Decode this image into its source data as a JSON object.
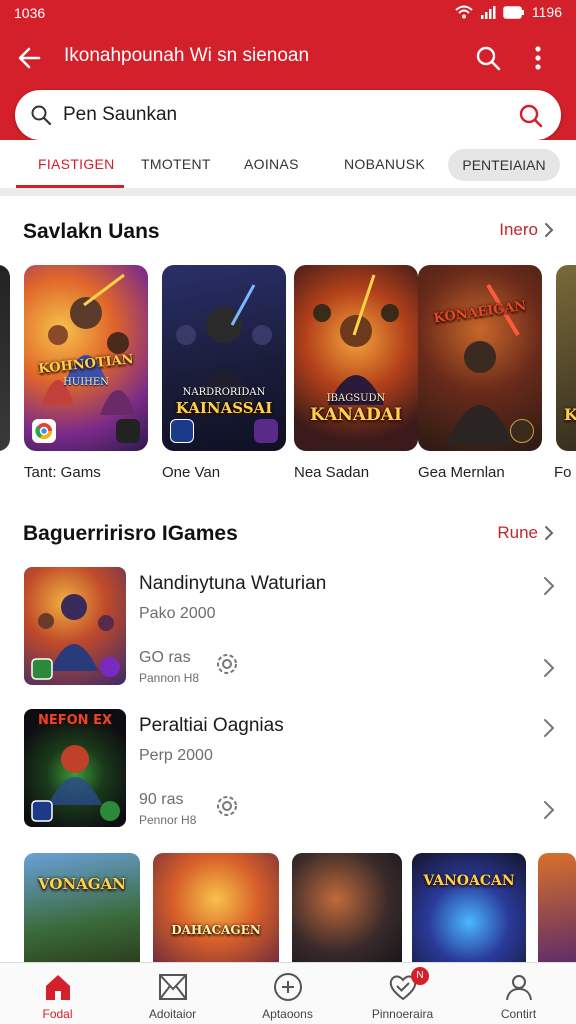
{
  "status_bar": {
    "time": "1036",
    "battery": "1196"
  },
  "app_bar": {
    "title": "Ikonahpounah Wi sn sienoan"
  },
  "search": {
    "value": "Pen Saunkan"
  },
  "tabs": [
    {
      "label": "FIASTIGEN",
      "active": true
    },
    {
      "label": "TMOTENT",
      "active": false
    },
    {
      "label": "AOINAS",
      "active": false
    },
    {
      "label": "NOBANUSK",
      "active": false
    },
    {
      "label": "PENTEIAIAN",
      "active": false
    }
  ],
  "featured": {
    "title": "Savlakn Uans",
    "more_label": "Inero",
    "cards": [
      {
        "label": "Tant: Gams",
        "art_title": "KOHNOTIAN",
        "art_sub": "HUIHEN",
        "icon": "chrome-badge-icon"
      },
      {
        "label": "One Van",
        "art_title": "KAINASSAI",
        "art_sub": "NARDRORIDAN",
        "icon": "game-badge-icon"
      },
      {
        "label": "Nea Sadan",
        "art_title": "KANADAI",
        "art_sub": "IBAGSUDN",
        "icon": "game-badge-icon"
      },
      {
        "label": "Gea Mernlan",
        "art_title": "KONAEIGAN",
        "art_sub": "",
        "icon": "game-badge-icon"
      },
      {
        "label": "Fo",
        "art_title": "K",
        "art_sub": "",
        "icon": "game-badge-icon"
      }
    ]
  },
  "popular": {
    "title": "Baguerririsro IGames",
    "more_label": "Rune",
    "items": [
      {
        "title": "Nandinytuna Waturian",
        "subtitle": "Pako 2000",
        "meta_primary": "GO ras",
        "meta_secondary": "Pannon H8"
      },
      {
        "title": "Peraltiai Oagnias",
        "subtitle": "Perp 2000",
        "meta_primary": "90 ras",
        "meta_secondary": "Pennor H8",
        "thumb_title": "NEFON EX"
      }
    ]
  },
  "bottom_row_cards": [
    {
      "art_title": "VONAGAN"
    },
    {
      "art_title": "DAHACAGEN"
    },
    {
      "art_title": ""
    },
    {
      "art_title": "VANOACAN"
    },
    {
      "art_title": ""
    }
  ],
  "bottom_nav": [
    {
      "label": "Fodal",
      "icon": "home-icon",
      "active": true
    },
    {
      "label": "Adoitaior",
      "icon": "mail-icon",
      "active": false
    },
    {
      "label": "Aptaoons",
      "icon": "plus-circle-icon",
      "active": false
    },
    {
      "label": "Pinnoeraira",
      "icon": "heart-check-icon",
      "active": false,
      "badge": "N"
    },
    {
      "label": "Contirt",
      "icon": "person-icon",
      "active": false
    }
  ],
  "colors": {
    "brand_red": "#d3202a",
    "link_red": "#c0272d"
  }
}
